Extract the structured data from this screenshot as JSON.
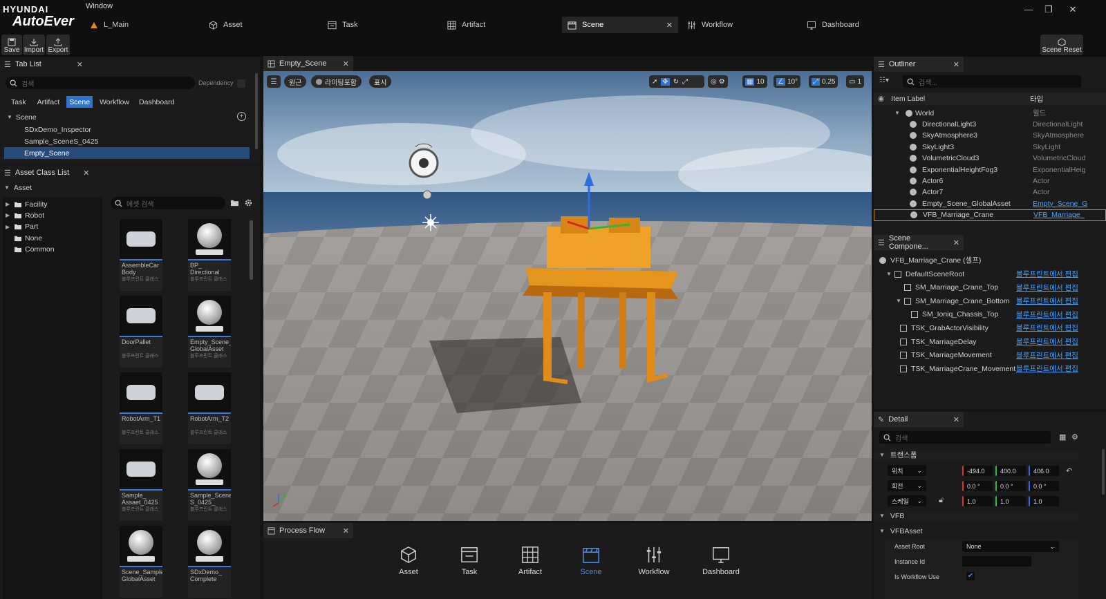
{
  "app": {
    "logo_top": "HYUNDAI",
    "logo_bottom": "AutoEver",
    "menu_window": "Window"
  },
  "main_tabs": [
    {
      "label": "L_Main",
      "icon": "level-icon"
    },
    {
      "label": "Asset",
      "icon": "cube-icon"
    },
    {
      "label": "Task",
      "icon": "task-icon"
    },
    {
      "label": "Artifact",
      "icon": "grid-icon"
    },
    {
      "label": "Scene",
      "icon": "clapper-icon",
      "active": true
    },
    {
      "label": "Workflow",
      "icon": "sliders-icon"
    },
    {
      "label": "Dashboard",
      "icon": "monitor-icon"
    }
  ],
  "toolbar": {
    "save": "Save",
    "import": "Import",
    "export": "Export",
    "scene_reset": "Scene Reset"
  },
  "tab_list": {
    "title": "Tab List",
    "search_placeholder": "검색",
    "dependency": "Dependency",
    "filters": [
      "Task",
      "Artifact",
      "Scene",
      "Workflow",
      "Dashboard"
    ],
    "active_filter": "Scene",
    "group": "Scene",
    "items": [
      "SDxDemo_Inspector",
      "Sample_SceneS_0425",
      "Empty_Scene"
    ],
    "selected": "Empty_Scene"
  },
  "asset_class_list": {
    "title": "Asset Class List",
    "root": "Asset",
    "tree": [
      "Facility",
      "Robot",
      "Part",
      "None",
      "Common"
    ],
    "search_placeholder": "에셋 검색",
    "tiles": [
      {
        "name": "AssembleCar Body",
        "class": "블루프린트 클래스"
      },
      {
        "name": "BP_ Directional",
        "class": "블루프린트 클래스"
      },
      {
        "name": "DoorPallet",
        "class": "블루프린트 클래스"
      },
      {
        "name": "Empty_Scene_ GlobalAsset",
        "class": "블루프린트 클래스"
      },
      {
        "name": "RobotArm_T1",
        "class": "블루프린트 클래스"
      },
      {
        "name": "RobotArm_T2",
        "class": "블루프린트 클래스"
      },
      {
        "name": "Sample_ Assaet_0425",
        "class": "블루프린트 클래스"
      },
      {
        "name": "Sample_Scene S_0425_",
        "class": "블루프린트 클래스"
      },
      {
        "name": "Scene_Sample GlobalAsset",
        "class": ""
      },
      {
        "name": "SDxDemo_ Complete",
        "class": ""
      }
    ]
  },
  "viewport": {
    "tab_title": "Empty_Scene",
    "btn_perspective": "원근",
    "btn_lighting": "라이팅포함",
    "btn_show": "표시",
    "grid_snap": "10",
    "rot_snap": "10°",
    "scale_snap": "0.25",
    "camera_speed": "1"
  },
  "process_flow": {
    "title": "Process Flow",
    "items": [
      {
        "label": "Asset",
        "icon": "cube-icon"
      },
      {
        "label": "Task",
        "icon": "task-icon"
      },
      {
        "label": "Artifact",
        "icon": "grid-icon"
      },
      {
        "label": "Scene",
        "icon": "clapper-icon",
        "active": true
      },
      {
        "label": "Workflow",
        "icon": "sliders-icon"
      },
      {
        "label": "Dashboard",
        "icon": "monitor-icon"
      }
    ]
  },
  "outliner": {
    "title": "Outliner",
    "search_placeholder": "검색...",
    "col_label": "Item Label",
    "col_type": "타입",
    "rows": [
      {
        "label": "World",
        "type": "월드"
      },
      {
        "label": "DirectionalLight3",
        "type": "DirectionalLight"
      },
      {
        "label": "SkyAtmosphere3",
        "type": "SkyAtmosphere"
      },
      {
        "label": "SkyLight3",
        "type": "SkyLight"
      },
      {
        "label": "VolumetricCloud3",
        "type": "VolumetricCloud"
      },
      {
        "label": "ExponentialHeightFog3",
        "type": "ExponentialHeig"
      },
      {
        "label": "Actor6",
        "type": "Actor"
      },
      {
        "label": "Actor7",
        "type": "Actor"
      },
      {
        "label": "Empty_Scene_GlobalAsset",
        "type": "Empty_Scene_G"
      },
      {
        "label": "VFB_Marriage_Crane",
        "type": "VFB_Marriage_"
      }
    ]
  },
  "scene_components": {
    "title": "Scene Compone...",
    "root": "VFB_Marriage_Crane (셀프)",
    "edit_link": "블루프린트에서 편집",
    "rows": [
      "DefaultSceneRoot",
      "SM_Marriage_Crane_Top",
      "SM_Marriage_Crane_Bottom",
      "SM_Ioniq_Chassis_Top",
      "TSK_GrabActorVisibility",
      "TSK_MarriageDelay",
      "TSK_MarriageMovement",
      "TSK_MarriageCrane_Movement"
    ]
  },
  "detail": {
    "title": "Detail",
    "search_placeholder": "검색",
    "transform_section": "트랜스폼",
    "location_label": "위치",
    "location": [
      "-494.0",
      "400.0",
      "406.0"
    ],
    "rotation_label": "회전",
    "rotation": [
      "0.0 °",
      "0.0 °",
      "0.0 °"
    ],
    "scale_label": "스케일",
    "scale": [
      "1.0",
      "1.0",
      "1.0"
    ],
    "vfb_section": "VFB",
    "vfbasset_section": "VFBAsset",
    "asset_root_label": "Asset Root",
    "asset_root_value": "None",
    "instance_id_label": "Instance Id",
    "instance_id_value": "",
    "is_workflow_use_label": "Is Workflow Use",
    "is_workflow_use": true
  }
}
